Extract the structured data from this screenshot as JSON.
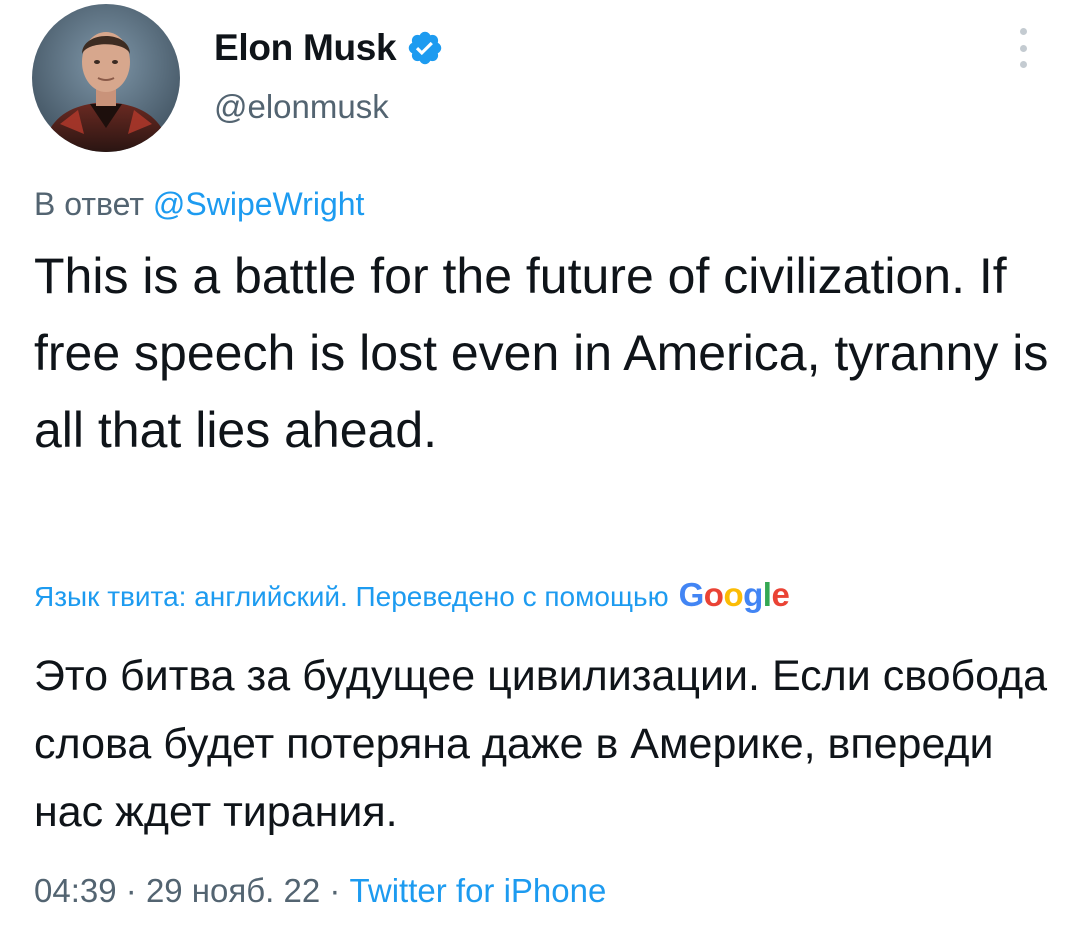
{
  "author": {
    "display_name": "Elon Musk",
    "handle": "@elonmusk",
    "verified": true,
    "avatar_icon": "profile-photo"
  },
  "reply": {
    "prefix": "В ответ",
    "mention": "@SwipeWright"
  },
  "tweet": {
    "text": "This is a battle for the future of civilization. If free speech is lost even in America, tyranny is all that lies ahead."
  },
  "translation": {
    "notice": "Язык твита: английский. Переведено с помощью",
    "provider": "Google",
    "text": "Это битва за будущее цивилизации. Если свобода слова будет потеряна даже в Америке, впереди нас ждет тирания."
  },
  "meta": {
    "time": "04:39",
    "separator": "·",
    "date": "29 нояб. 22",
    "source": "Twitter for iPhone"
  },
  "colors": {
    "accent": "#1d9bf0",
    "text": "#0f1419",
    "secondary": "#536471"
  }
}
